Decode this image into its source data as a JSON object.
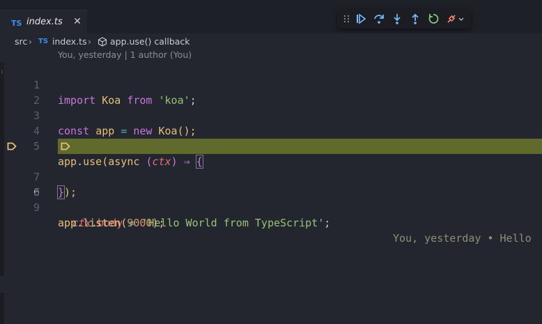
{
  "tab": {
    "lang_badge": "TS",
    "label": "index.ts",
    "close": "✕"
  },
  "breadcrumb": {
    "folder": "src",
    "file_badge": "TS",
    "file": "index.ts",
    "symbol": "app.use() callback"
  },
  "codelens": {
    "author_line": "You, yesterday | 1 author (You)"
  },
  "debug_toolbar": {
    "buttons": [
      "drag-grip",
      "continue",
      "step-over",
      "step-into",
      "step-out",
      "restart",
      "disconnect"
    ]
  },
  "editor": {
    "current_line": 6,
    "breakpoint_line": 6,
    "lines": [
      {
        "n": "1",
        "parts": [
          "import",
          "Koa",
          "from",
          "'koa'",
          ";"
        ]
      },
      {
        "n": "2"
      },
      {
        "n": "3",
        "parts": [
          "const",
          "app",
          "=",
          "new",
          "Koa",
          "();"
        ]
      },
      {
        "n": "4"
      },
      {
        "n": "5",
        "parts": [
          "app",
          ".",
          "use",
          "(",
          "async",
          "(",
          "ctx",
          ")",
          "⇒",
          "{"
        ]
      },
      {
        "n": "6",
        "parts": [
          "ctx",
          ".",
          "body",
          "=",
          "'Hello World from TypeScript'",
          ";"
        ]
      },
      {
        "n": "7",
        "parts": [
          "}",
          ");"
        ]
      },
      {
        "n": "8"
      },
      {
        "n": "9",
        "parts": [
          "app",
          ".",
          "listen",
          "(",
          "9000",
          ");"
        ]
      }
    ],
    "inline_blame": "You, yesterday • Hello"
  },
  "colors": {
    "editor_bg": "#23262e",
    "current_line_highlight": "#5f6a2c",
    "breakpoint": "#e5c07b"
  }
}
